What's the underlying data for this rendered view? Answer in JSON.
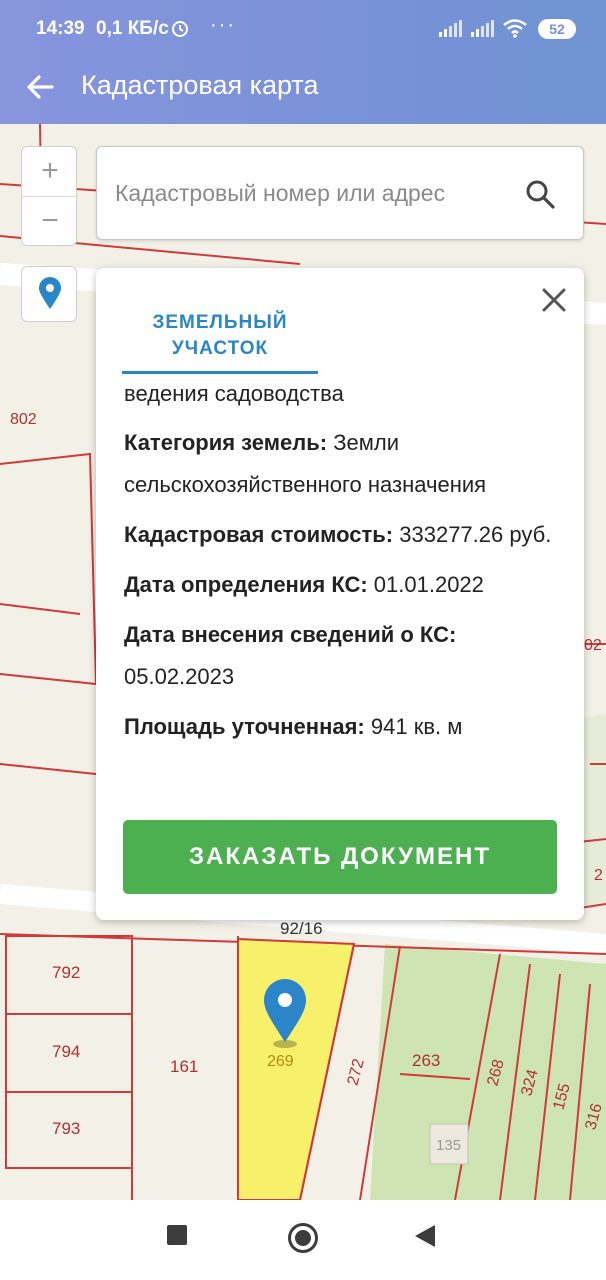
{
  "status": {
    "time": "14:39",
    "speed": "0,1 КБ/с",
    "dots": "···",
    "battery": "52"
  },
  "appbar": {
    "title": "Кадастровая карта"
  },
  "search": {
    "placeholder": "Кадастровый номер или адрес"
  },
  "map": {
    "labels": {
      "n802": "802",
      "n02": "02",
      "n2": "2",
      "n92_16": "92/16",
      "n792": "792",
      "n794": "794",
      "n793": "793",
      "n161": "161",
      "n269": "269",
      "n272": "272",
      "n263": "263",
      "n268": "268",
      "n324": "324",
      "n155": "155",
      "n316": "316",
      "n135": "135"
    },
    "colors": {
      "background": "#f3f1e7",
      "parcel_line": "#d03a3a",
      "selected_parcel": "#f7f06a",
      "green_area": "#cfe4b3",
      "marker": "#2a86c8"
    }
  },
  "popup": {
    "tab_label": "ЗЕМЕЛЬНЫЙ УЧАСТОК",
    "usage_text": "ведения садоводства",
    "category_label": "Категория земель:",
    "category_value": "Земли сельскохозяйственного назначения",
    "cost_label": "Кадастровая стоимость:",
    "cost_value": "333277.26 руб.",
    "date_ks_label": "Дата определения КС:",
    "date_ks_value": "01.01.2022",
    "date_entry_label": "Дата внесения сведений о КС:",
    "date_entry_value": "05.02.2023",
    "area_label": "Площадь уточненная:",
    "area_value": "941 кв. м",
    "order_button": "ЗАКАЗАТЬ ДОКУМЕНТ"
  },
  "zoom": {
    "in_label": "+",
    "out_label": "−"
  }
}
